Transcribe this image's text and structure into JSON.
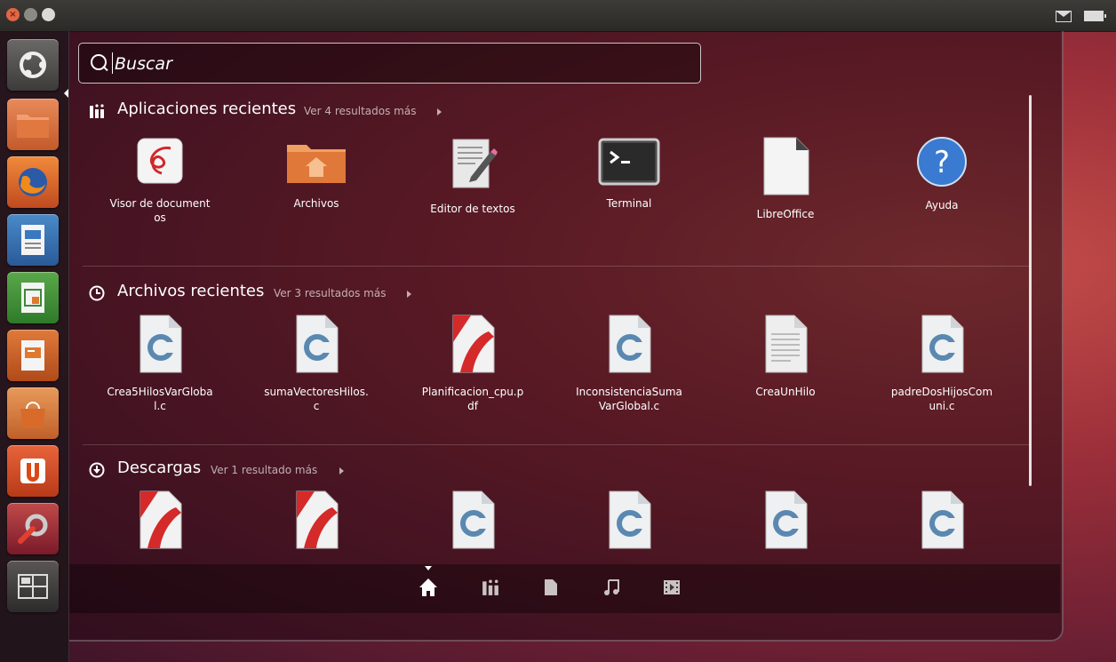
{
  "dash": {
    "search": {
      "placeholder": "Buscar"
    },
    "categories": [
      {
        "title": "Aplicaciones recientes",
        "more": "Ver 4 resultados más",
        "icon": "apps-icon"
      },
      {
        "title": "Archivos recientes",
        "more": "Ver 3 resultados más",
        "icon": "clock-icon"
      },
      {
        "title": "Descargas",
        "more": "Ver 1 resultado más",
        "icon": "download-icon"
      }
    ],
    "recent_apps": [
      {
        "label": "Visor de documentos",
        "icon": "document-viewer-icon"
      },
      {
        "label": "Archivos",
        "icon": "home-folder-icon"
      },
      {
        "label": "Editor de textos",
        "icon": "text-editor-icon"
      },
      {
        "label": "Terminal",
        "icon": "terminal-icon"
      },
      {
        "label": "LibreOffice",
        "icon": "libreoffice-icon"
      },
      {
        "label": "Ayuda",
        "icon": "help-icon"
      }
    ],
    "recent_files": [
      {
        "label": "Crea5HilosVarGlobal.c",
        "icon": "c-file-icon"
      },
      {
        "label": "sumaVectoresHilos.c",
        "icon": "c-file-icon"
      },
      {
        "label": "Planificacion_cpu.pdf",
        "icon": "pdf-file-icon"
      },
      {
        "label": "InconsistenciaSumaVarGlobal.c",
        "icon": "c-file-icon"
      },
      {
        "label": "CreaUnHilo",
        "icon": "text-file-icon"
      },
      {
        "label": "padreDosHijosComuni.c",
        "icon": "c-file-icon"
      }
    ],
    "downloads": [
      {
        "icon": "pdf-file-icon"
      },
      {
        "icon": "pdf-file-icon"
      },
      {
        "icon": "c-file-icon"
      },
      {
        "icon": "c-file-icon"
      },
      {
        "icon": "c-file-icon"
      },
      {
        "icon": "c-file-icon"
      }
    ],
    "lenses": [
      {
        "name": "home-lens-icon",
        "active": true
      },
      {
        "name": "applications-lens-icon",
        "active": false
      },
      {
        "name": "files-lens-icon",
        "active": false
      },
      {
        "name": "music-lens-icon",
        "active": false
      },
      {
        "name": "video-lens-icon",
        "active": false
      }
    ]
  },
  "launcher": {
    "items": [
      "dash-home-icon",
      "files-icon",
      "firefox-icon",
      "writer-icon",
      "calc-icon",
      "impress-icon",
      "software-center-icon",
      "ubuntu-one-icon",
      "system-settings-icon",
      "workspace-switcher-icon"
    ]
  },
  "colors": {
    "accent": "#dd4814",
    "background": "#9c2f3a"
  }
}
